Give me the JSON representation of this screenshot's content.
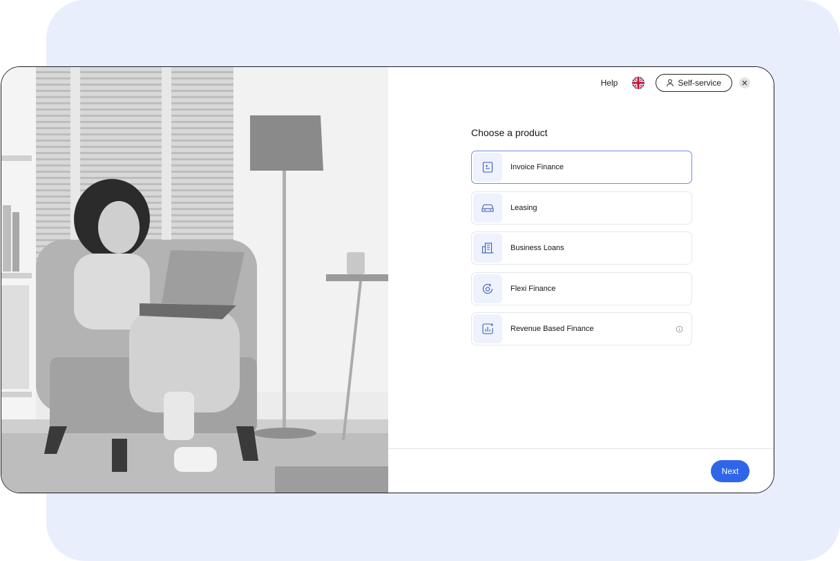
{
  "header": {
    "help_label": "Help",
    "language_icon": "uk-flag-icon",
    "self_service_label": "Self-service",
    "close_icon": "close-icon"
  },
  "main": {
    "title": "Choose a product",
    "products": [
      {
        "label": "Invoice Finance",
        "icon": "invoice-icon",
        "selected": true
      },
      {
        "label": "Leasing",
        "icon": "car-icon",
        "selected": false
      },
      {
        "label": "Business Loans",
        "icon": "building-icon",
        "selected": false
      },
      {
        "label": "Flexi Finance",
        "icon": "refresh-coin-icon",
        "selected": false
      },
      {
        "label": "Revenue Based Finance",
        "icon": "chart-icon",
        "selected": false,
        "info": true
      }
    ]
  },
  "footer": {
    "next_label": "Next"
  },
  "colors": {
    "accent": "#2f66e9",
    "backdrop": "#e8eefc",
    "icon_bg": "#eef2fc",
    "selected_border": "#6f8fdd"
  }
}
